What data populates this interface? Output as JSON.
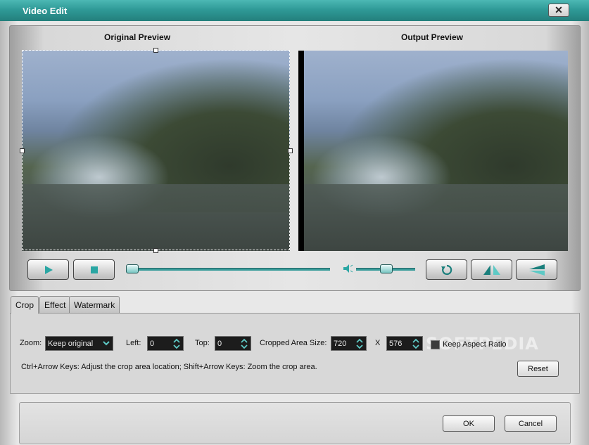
{
  "window": {
    "title": "Video Edit",
    "close_glyph": "✕"
  },
  "preview": {
    "original_label": "Original Preview",
    "output_label": "Output Preview"
  },
  "playback": {
    "play_icon": "play-icon",
    "stop_icon": "stop-icon",
    "progress": 0.0,
    "volume": 0.5,
    "rotate_icon": "rotate-icon",
    "flip_horizontal_icon": "flip-horizontal-icon",
    "flip_vertical_icon": "flip-vertical-icon"
  },
  "tabs": [
    {
      "label": "Crop",
      "active": true
    },
    {
      "label": "Effect",
      "active": false
    },
    {
      "label": "Watermark",
      "active": false
    }
  ],
  "crop": {
    "zoom_label": "Zoom:",
    "zoom_value": "Keep original",
    "left_label": "Left:",
    "left_value": "0",
    "top_label": "Top:",
    "top_value": "0",
    "area_label": "Cropped Area Size:",
    "width_value": "720",
    "x_label": "X",
    "height_value": "576",
    "aspect_label": "Keep Aspect Ratio",
    "hint": "Ctrl+Arrow Keys: Adjust the crop area location; Shift+Arrow Keys: Zoom the crop area.",
    "reset_label": "Reset"
  },
  "footer": {
    "ok_label": "OK",
    "cancel_label": "Cancel"
  },
  "watermark_text": "SOFTPEDIA",
  "colors": {
    "accent": "#3a9d9b",
    "titlebar": "#2f9a97"
  }
}
